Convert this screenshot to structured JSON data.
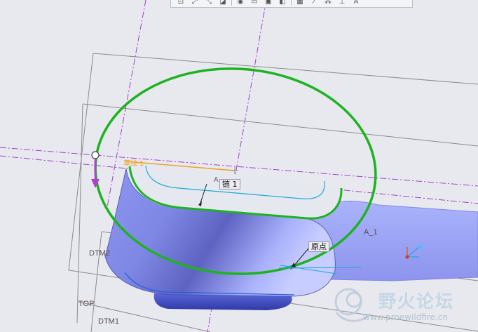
{
  "toolbar": {
    "buttons": [
      {
        "name": "zoom-fit-icon",
        "glyph": "⊡"
      },
      {
        "name": "zoom-in-icon",
        "glyph": "⤢"
      },
      {
        "name": "zoom-out-icon",
        "glyph": "⤡"
      },
      {
        "name": "view-orient-icon",
        "glyph": "◪"
      },
      {
        "name": "shading-icon",
        "glyph": "◉"
      },
      {
        "name": "saved-views-icon",
        "glyph": "▭"
      },
      {
        "name": "layers-icon",
        "glyph": "▣"
      },
      {
        "name": "display-style-icon",
        "glyph": "◧"
      },
      {
        "name": "datum-planes-icon",
        "glyph": "▦"
      },
      {
        "name": "datum-axes-icon",
        "glyph": "⁄"
      },
      {
        "name": "datum-points-icon",
        "glyph": "⁂"
      },
      {
        "name": "coordinate-system-icon",
        "glyph": "⊥"
      },
      {
        "name": "annotations-icon",
        "glyph": "A"
      }
    ]
  },
  "labels": {
    "sketch": "草绘 1",
    "axis_a_small": "A",
    "chain": "链 1",
    "axis_a1": "A_1",
    "origin": "原点",
    "dtm2": "DTM2",
    "top": "TOP",
    "dtm1": "DTM1"
  },
  "watermark": {
    "text": "野火论坛",
    "url": "www.proewildfire.cn"
  },
  "colors": {
    "background": "#e8e9ee",
    "model_face": "#9aa2f4",
    "highlight_circle": "#1db320",
    "datum_axis": "#a040d0",
    "sketch_orange": "#f0a020",
    "chain_cyan": "#1aa8d8",
    "pull_arrow": "#b040d0",
    "datum_plane": "#8b8b8b"
  }
}
